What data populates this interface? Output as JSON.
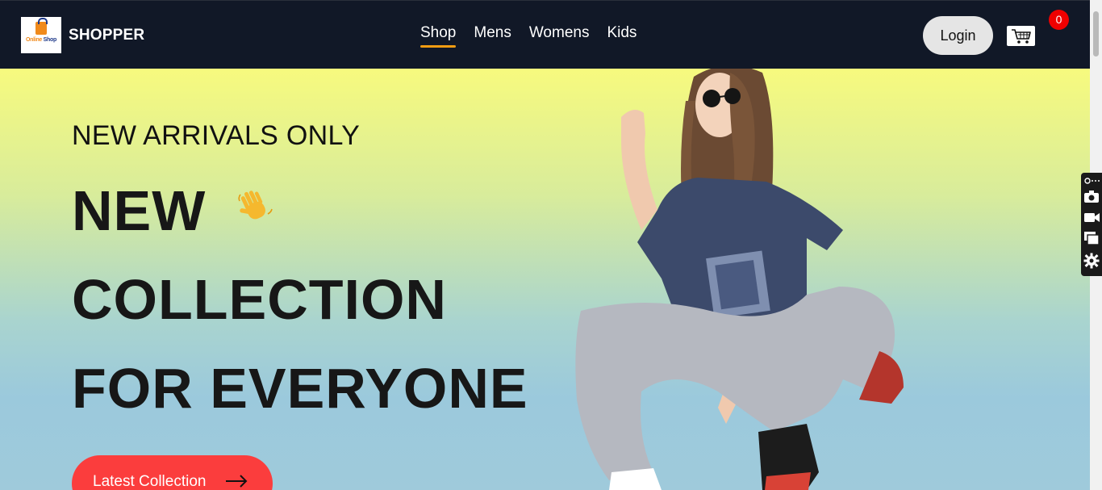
{
  "navbar": {
    "logo": {
      "line1a": "Online",
      "line1b": "Shop",
      "tagline": ""
    },
    "brand": "SHOPPER",
    "links": [
      {
        "label": "Shop",
        "active": true
      },
      {
        "label": "Mens",
        "active": false
      },
      {
        "label": "Womens",
        "active": false
      },
      {
        "label": "Kids",
        "active": false
      }
    ],
    "login_label": "Login",
    "cart_icon": "cart-icon",
    "cart_count": "0"
  },
  "hero": {
    "kicker": "NEW ARRIVALS ONLY",
    "line1": "NEW",
    "line2": "COLLECTION",
    "line3": "FOR EVERYONE",
    "wave_icon": "waving-hand-icon",
    "cta_label": "Latest Collection",
    "cta_icon": "arrow-right-icon",
    "image": "hero-model-image"
  },
  "tool_panel": {
    "icons": [
      "link-icon",
      "camera-icon",
      "video-icon",
      "windows-icon",
      "gear-icon"
    ]
  },
  "colors": {
    "navbar_bg": "#111827",
    "active_underline": "#f39c12",
    "cta_bg": "#fb3d3d",
    "badge_bg": "#ef0000",
    "gradient_top": "#f7fa7e",
    "gradient_bottom": "#9fcadb"
  }
}
